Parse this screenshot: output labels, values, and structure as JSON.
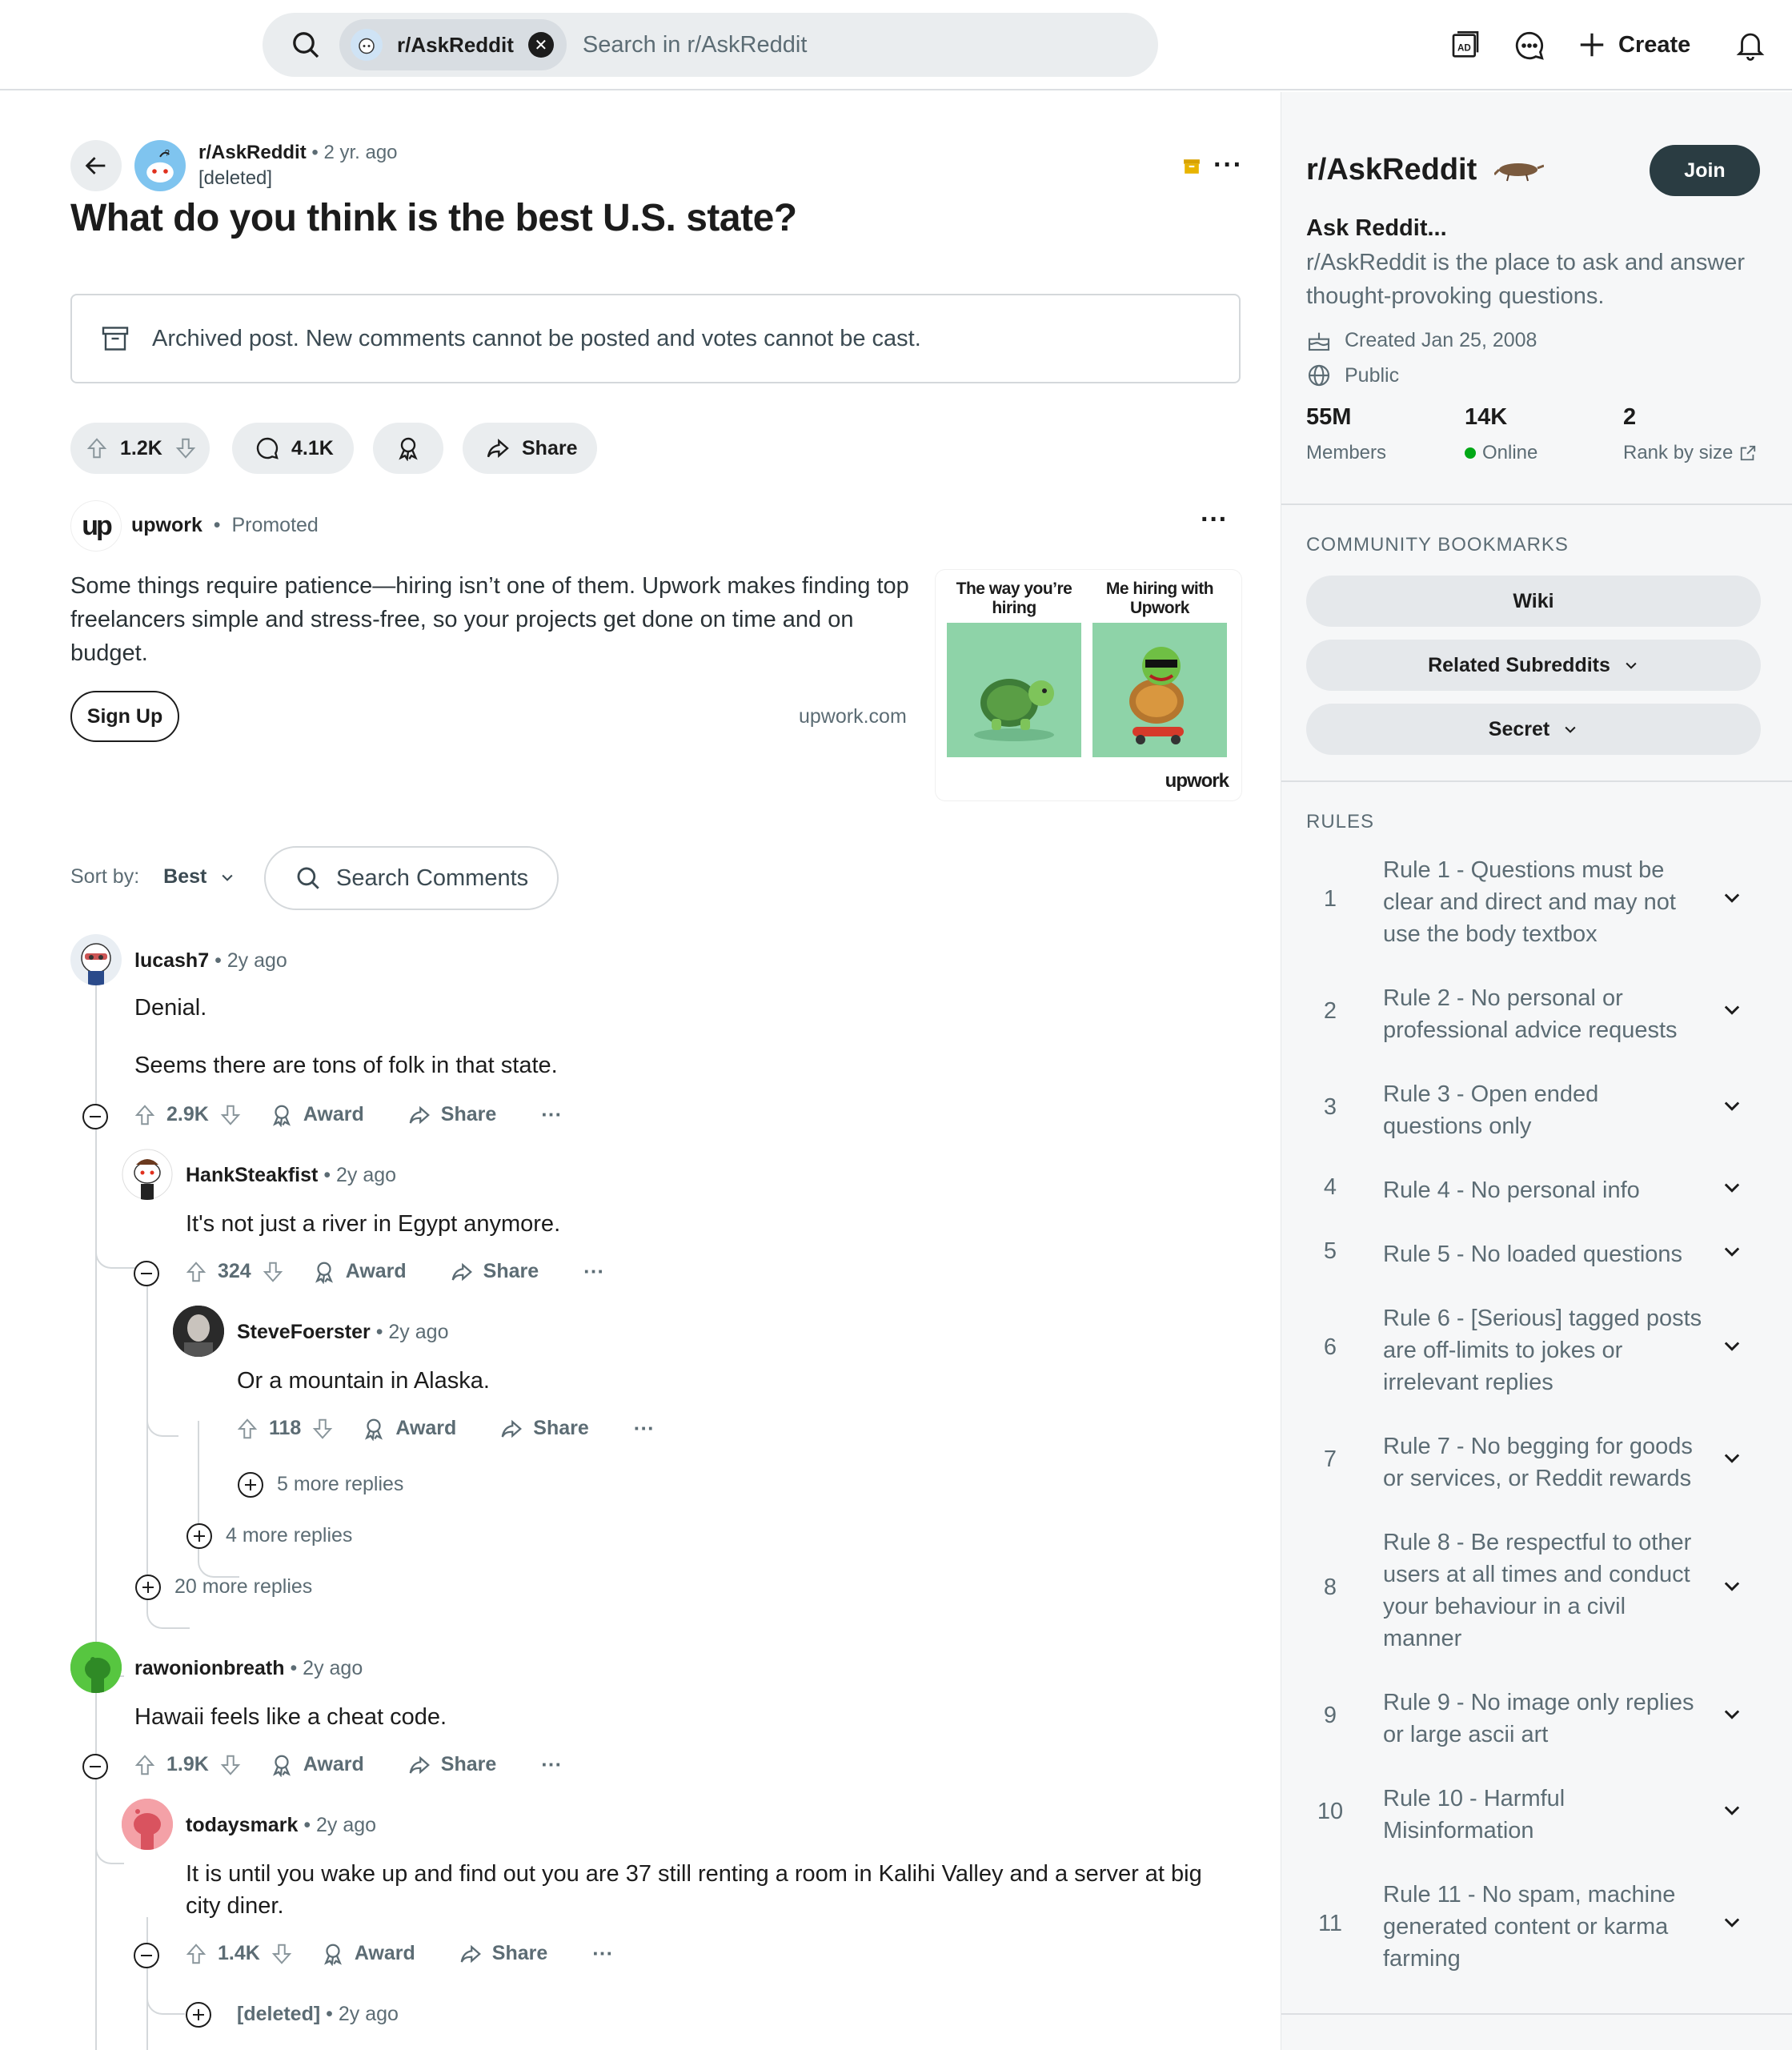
{
  "header": {
    "chip_label": "r/AskReddit",
    "search_placeholder": "Search in r/AskReddit",
    "create_label": "Create"
  },
  "post": {
    "subreddit": "r/AskReddit",
    "time": "2 yr. ago",
    "author": "[deleted]",
    "title": "What do you think is the best U.S. state?",
    "archived_notice": "Archived post. New comments cannot be posted and votes cannot be cast.",
    "upvotes": "1.2K",
    "comments": "4.1K",
    "share_label": "Share"
  },
  "ad": {
    "advertiser": "upwork",
    "promoted": "Promoted",
    "body": "Some things require patience—hiring isn’t one of them. Upwork makes finding top freelancers simple and stress-free, so your projects get done on time and on budget.",
    "cta": "Sign Up",
    "domain": "upwork.com",
    "caption_left": "The way you’re hiring",
    "caption_right": "Me hiring with Upwork",
    "brand": "upwork"
  },
  "sort": {
    "label": "Sort by:",
    "value": "Best",
    "search_placeholder": "Search Comments"
  },
  "comments": [
    {
      "author": "lucash7",
      "time": "2y ago",
      "line1": "Denial.",
      "line2": "Seems there are tons of folk in that state.",
      "votes": "2.9K"
    },
    {
      "author": "HankSteakfist",
      "time": "2y ago",
      "text": "It's not just a river in Egypt anymore.",
      "votes": "324"
    },
    {
      "author": "SteveFoerster",
      "time": "2y ago",
      "text": "Or a mountain in Alaska.",
      "votes": "118"
    },
    {
      "author": "rawonionbreath",
      "time": "2y ago",
      "text": "Hawaii feels like a cheat code.",
      "votes": "1.9K"
    },
    {
      "author": "todaysmark",
      "time": "2y ago",
      "text": "It is until you wake up and find out you are 37 still renting a room in Kalihi Valley and a server at big city diner.",
      "votes": "1.4K"
    },
    {
      "author": "[deleted]",
      "time": "2y ago"
    }
  ],
  "more_replies": [
    "5 more replies",
    "4 more replies",
    "20 more replies"
  ],
  "action_labels": {
    "award": "Award",
    "share": "Share"
  },
  "sidebar": {
    "title": "r/AskReddit",
    "join": "Join",
    "name": "Ask Reddit...",
    "description": "r/AskReddit is the place to ask and answer thought-provoking questions.",
    "created": "Created Jan 25, 2008",
    "visibility": "Public",
    "members_value": "55M",
    "members_label": "Members",
    "online_value": "14K",
    "online_label": "Online",
    "rank_value": "2",
    "rank_label": "Rank by size",
    "bookmarks_heading": "COMMUNITY BOOKMARKS",
    "bookmarks": [
      "Wiki",
      "Related Subreddits",
      "Secret"
    ],
    "rules_heading": "RULES",
    "rules": [
      {
        "n": "1",
        "text": "Rule 1 - Questions must be clear and direct and may not use the body textbox"
      },
      {
        "n": "2",
        "text": "Rule 2 - No personal or professional advice requests"
      },
      {
        "n": "3",
        "text": "Rule 3 - Open ended questions only"
      },
      {
        "n": "4",
        "text": "Rule 4 - No personal info"
      },
      {
        "n": "5",
        "text": "Rule 5 - No loaded questions"
      },
      {
        "n": "6",
        "text": "Rule 6 - [Serious] tagged posts are off-limits to jokes or irrelevant replies"
      },
      {
        "n": "7",
        "text": "Rule 7 - No begging for goods or services, or Reddit rewards"
      },
      {
        "n": "8",
        "text": "Rule 8 - Be respectful to other users at all times and conduct your behaviour in a civil manner"
      },
      {
        "n": "9",
        "text": "Rule 9 - No image only replies or large ascii art"
      },
      {
        "n": "10",
        "text": "Rule 10 - Harmful Misinformation"
      },
      {
        "n": "11",
        "text": "Rule 11 - No spam, machine generated content or karma farming"
      }
    ]
  },
  "colors": {
    "join_bg": "#2a3c42",
    "online_dot": "#01a816",
    "archive_icon": "#d8a200"
  }
}
